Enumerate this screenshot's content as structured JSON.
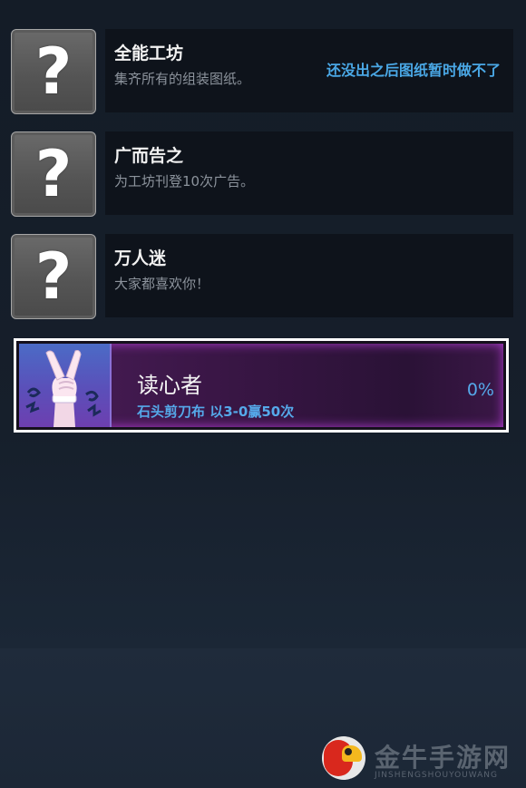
{
  "achievements": [
    {
      "title": "全能工坊",
      "description": "集齐所有的组装图纸。",
      "note": "还没出之后图纸暂时做不了",
      "icon": "question-mark-icon",
      "locked": true
    },
    {
      "title": "广而告之",
      "description": "为工坊刊登10次广告。",
      "icon": "question-mark-icon",
      "locked": true
    },
    {
      "title": "万人迷",
      "description": "大家都喜欢你！",
      "icon": "question-mark-icon",
      "locked": true
    }
  ],
  "locked_icon_glyph": "?",
  "unlocked_achievement": {
    "title": "读心者",
    "description": "石头剪刀布 以3-0赢50次",
    "progress": "0%",
    "icon": "victory-hand-icon"
  },
  "watermark": {
    "text": "金牛手游网",
    "subtext": "JINSHENGSHOUYOUWANG"
  },
  "colors": {
    "accent_blue": "#4aa8e6",
    "highlight_purple": "#4a1d58",
    "background": "#161f2b"
  }
}
